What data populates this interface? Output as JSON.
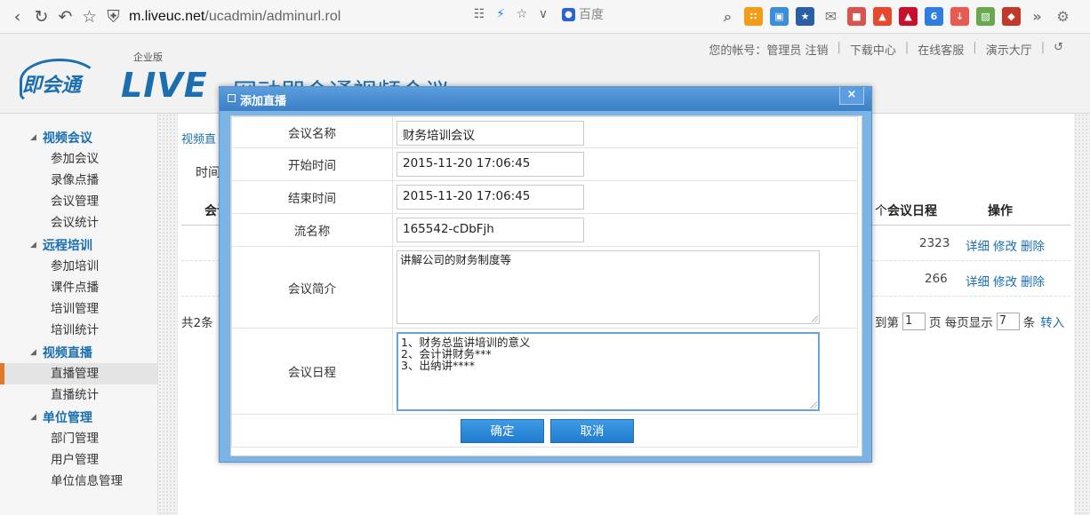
{
  "browser": {
    "url_host": "m.liveuc.net",
    "url_path": "/ucadmin/adminurl.rol",
    "search_engine": "百度",
    "icons": [
      "back-icon",
      "reload-icon",
      "undo-icon",
      "star-icon",
      "shield-icon",
      "grid-icon",
      "lightning-icon",
      "bookmark-star-icon",
      "dropdown-icon",
      "search-icon",
      "apps-icon",
      "settings-icon"
    ]
  },
  "header": {
    "logo_text": "即会通",
    "edition": "企业版",
    "brand": "LIVE",
    "site_title": "网动即会通视频会议",
    "links": [
      "您的帐号：管理员 注销",
      "下载中心",
      "在线客服",
      "演示大厅"
    ]
  },
  "sidebar": {
    "groups": [
      {
        "title": "视频会议",
        "items": [
          "参加会议",
          "录像点播",
          "会议管理",
          "会议统计"
        ]
      },
      {
        "title": "远程培训",
        "items": [
          "参加培训",
          "课件点播",
          "培训管理",
          "培训统计"
        ]
      },
      {
        "title": "视频直播",
        "items": [
          "直播管理",
          "直播统计"
        ]
      },
      {
        "title": "单位管理",
        "items": [
          "部门管理",
          "用户管理",
          "单位信息管理"
        ]
      }
    ],
    "active_item": "直播管理"
  },
  "main": {
    "breadcrumb": "视频直",
    "filter_label": "时间",
    "table_headers": {
      "first": "会议",
      "count_suffix": "个",
      "schedule": "会议日程",
      "actions": "操作"
    },
    "rows": [
      {
        "schedule": "2323",
        "actions": [
          "详细",
          "修改",
          "删除"
        ]
      },
      {
        "schedule": "266",
        "actions": [
          "详细",
          "修改",
          "删除"
        ]
      }
    ],
    "total": "共2条",
    "pager": {
      "prefix": "到第",
      "page": "1",
      "page_suffix": "页 每页显示",
      "per_page": "7",
      "per_page_suffix": "条",
      "go": "转入"
    }
  },
  "dialog": {
    "title": "添加直播",
    "close": "×",
    "fields": [
      {
        "label": "会议名称",
        "value": "财务培训会议"
      },
      {
        "label": "开始时间",
        "value": "2015-11-20 17:06:45"
      },
      {
        "label": "结束时间",
        "value": "2015-11-20 17:06:45"
      },
      {
        "label": "流名称",
        "value": "165542-cDbFjh"
      },
      {
        "label": "会议简介",
        "value": "讲解公司的财务制度等"
      },
      {
        "label": "会议日程",
        "value": "1、财务总监讲培训的意义\n2、会计讲财务***\n3、出纳讲****"
      }
    ],
    "confirm": "确定",
    "cancel": "取消"
  },
  "colors": {
    "brand_blue": "#1b6fb0",
    "dialog_blue": "#3b7fc6",
    "active_marker": "#e07828"
  }
}
